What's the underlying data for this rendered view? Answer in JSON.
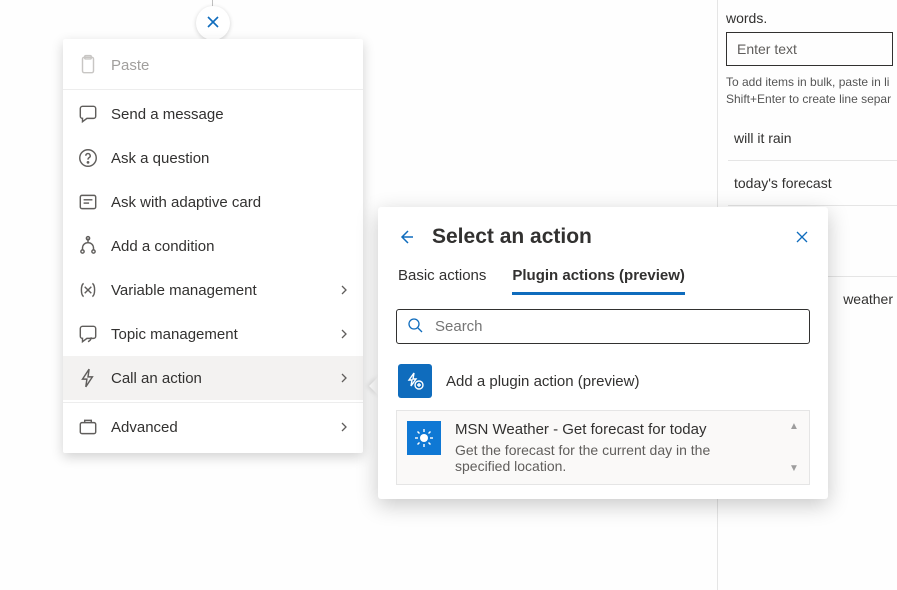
{
  "ctx_menu": {
    "items": [
      {
        "label": "Paste",
        "icon": "paste-icon",
        "disabled": true,
        "submenu": false
      },
      {
        "label": "Send a message",
        "icon": "message-icon",
        "disabled": false,
        "submenu": false
      },
      {
        "label": "Ask a question",
        "icon": "question-icon",
        "disabled": false,
        "submenu": false
      },
      {
        "label": "Ask with adaptive card",
        "icon": "card-icon",
        "disabled": false,
        "submenu": false
      },
      {
        "label": "Add a condition",
        "icon": "condition-icon",
        "disabled": false,
        "submenu": false
      },
      {
        "label": "Variable management",
        "icon": "variable-icon",
        "disabled": false,
        "submenu": true
      },
      {
        "label": "Topic management",
        "icon": "topic-icon",
        "disabled": false,
        "submenu": true
      },
      {
        "label": "Call an action",
        "icon": "action-icon",
        "disabled": false,
        "submenu": true,
        "selected": true
      },
      {
        "label": "Advanced",
        "icon": "advanced-icon",
        "disabled": false,
        "submenu": true
      }
    ]
  },
  "panel": {
    "title": "Select an action",
    "tabs": [
      {
        "label": "Basic actions",
        "active": false
      },
      {
        "label": "Plugin actions (preview)",
        "active": true
      }
    ],
    "search_placeholder": "Search",
    "add_plugin_label": "Add a plugin action (preview)",
    "results": [
      {
        "title": "MSN Weather - Get forecast for today",
        "subtitle": "Get the forecast for the current day in the specified location."
      }
    ]
  },
  "right_panel": {
    "cut_top": "words.",
    "input_placeholder": "Enter text",
    "hint_line1": "To add items in bulk, paste in li",
    "hint_line2": "Shift+Enter to create line separ",
    "phrases": [
      "will it rain",
      "today's forecast",
      "weather"
    ]
  }
}
